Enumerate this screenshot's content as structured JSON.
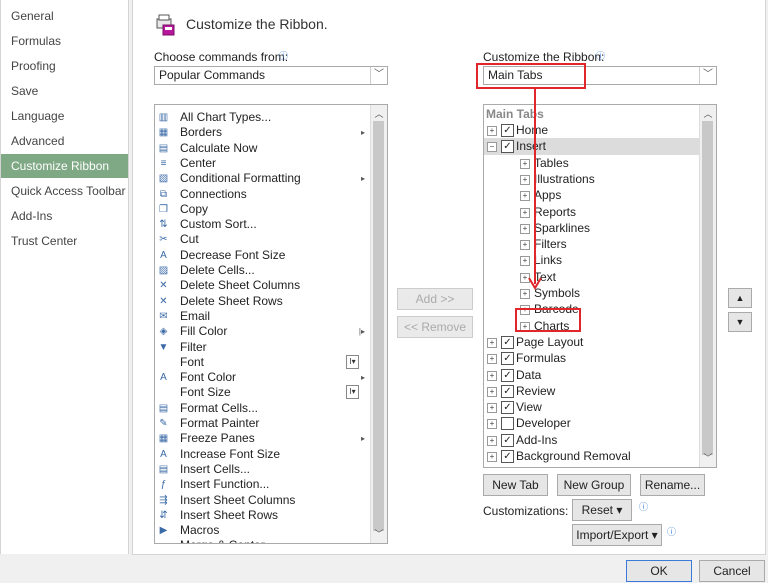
{
  "nav": {
    "items": [
      {
        "label": "General"
      },
      {
        "label": "Formulas"
      },
      {
        "label": "Proofing"
      },
      {
        "label": "Save"
      },
      {
        "label": "Language"
      },
      {
        "label": "Advanced"
      },
      {
        "label": "Customize Ribbon",
        "selected": true
      },
      {
        "label": "Quick Access Toolbar"
      },
      {
        "label": "Add-Ins"
      },
      {
        "label": "Trust Center"
      }
    ]
  },
  "header": {
    "title": "Customize the Ribbon.",
    "icon": "ribbon-customize-icon"
  },
  "left_pane": {
    "choose_label": "Choose commands from:",
    "choose_value": "Popular Commands",
    "commands": [
      {
        "label": "All Chart Types...",
        "icon": "chart-icon"
      },
      {
        "label": "Borders",
        "icon": "borders-icon",
        "sub": "▸"
      },
      {
        "label": "Calculate Now",
        "icon": "calculator-icon"
      },
      {
        "label": "Center",
        "icon": "align-center-icon"
      },
      {
        "label": "Conditional Formatting",
        "icon": "conditional-format-icon",
        "sub": "▸"
      },
      {
        "label": "Connections",
        "icon": "connections-icon"
      },
      {
        "label": "Copy",
        "icon": "copy-icon"
      },
      {
        "label": "Custom Sort...",
        "icon": "sort-icon"
      },
      {
        "label": "Cut",
        "icon": "scissors-icon"
      },
      {
        "label": "Decrease Font Size",
        "icon": "font-decrease-icon"
      },
      {
        "label": "Delete Cells...",
        "icon": "delete-cells-icon"
      },
      {
        "label": "Delete Sheet Columns",
        "icon": "delete-columns-icon"
      },
      {
        "label": "Delete Sheet Rows",
        "icon": "delete-rows-icon"
      },
      {
        "label": "Email",
        "icon": "email-icon"
      },
      {
        "label": "Fill Color",
        "icon": "fill-color-icon",
        "sub": "|▸"
      },
      {
        "label": "Filter",
        "icon": "filter-icon"
      },
      {
        "label": "Font",
        "icon": "",
        "box": "I▾"
      },
      {
        "label": "Font Color",
        "icon": "font-color-icon",
        "sub": "▸"
      },
      {
        "label": "Font Size",
        "icon": "",
        "box": "I▾"
      },
      {
        "label": "Format Cells...",
        "icon": "format-cells-icon"
      },
      {
        "label": "Format Painter",
        "icon": "format-painter-icon"
      },
      {
        "label": "Freeze Panes",
        "icon": "freeze-panes-icon",
        "sub": "▸"
      },
      {
        "label": "Increase Font Size",
        "icon": "font-increase-icon"
      },
      {
        "label": "Insert Cells...",
        "icon": "insert-cells-icon"
      },
      {
        "label": "Insert Function...",
        "icon": "function-icon"
      },
      {
        "label": "Insert Sheet Columns",
        "icon": "insert-columns-icon"
      },
      {
        "label": "Insert Sheet Rows",
        "icon": "insert-rows-icon"
      },
      {
        "label": "Macros",
        "icon": "macros-icon"
      },
      {
        "label": "Merge & Center",
        "icon": "merge-center-icon"
      }
    ]
  },
  "middle": {
    "add_label": "Add >>",
    "remove_label": "<< Remove"
  },
  "right_pane": {
    "customize_label": "Customize the Ribbon:",
    "customize_value": "Main Tabs",
    "tree_header": "Main Tabs",
    "tree": [
      {
        "label": "Home",
        "level": 0,
        "exp": "+",
        "checked": true
      },
      {
        "label": "Insert",
        "level": 0,
        "exp": "−",
        "checked": true,
        "selected": true
      },
      {
        "label": "Tables",
        "level": 1,
        "exp": "+"
      },
      {
        "label": "Illustrations",
        "level": 1,
        "exp": "+"
      },
      {
        "label": "Apps",
        "level": 1,
        "exp": "+"
      },
      {
        "label": "Reports",
        "level": 1,
        "exp": "+"
      },
      {
        "label": "Sparklines",
        "level": 1,
        "exp": "+"
      },
      {
        "label": "Filters",
        "level": 1,
        "exp": "+"
      },
      {
        "label": "Links",
        "level": 1,
        "exp": "+"
      },
      {
        "label": "Text",
        "level": 1,
        "exp": "+"
      },
      {
        "label": "Symbols",
        "level": 1,
        "exp": "+"
      },
      {
        "label": "Barcode",
        "level": 1,
        "exp": "+"
      },
      {
        "label": "Charts",
        "level": 1,
        "exp": "+"
      },
      {
        "label": "Page Layout",
        "level": 0,
        "exp": "+",
        "checked": true
      },
      {
        "label": "Formulas",
        "level": 0,
        "exp": "+",
        "checked": true
      },
      {
        "label": "Data",
        "level": 0,
        "exp": "+",
        "checked": true
      },
      {
        "label": "Review",
        "level": 0,
        "exp": "+",
        "checked": true
      },
      {
        "label": "View",
        "level": 0,
        "exp": "+",
        "checked": true
      },
      {
        "label": "Developer",
        "level": 0,
        "exp": "+",
        "checked": false
      },
      {
        "label": "Add-Ins",
        "level": 0,
        "exp": "+",
        "checked": true
      },
      {
        "label": "Background Removal",
        "level": 0,
        "exp": "+",
        "checked": true
      }
    ],
    "new_tab": "New Tab",
    "new_group": "New Group",
    "rename": "Rename...",
    "customizations_label": "Customizations:",
    "reset": "Reset ▾",
    "import_export": "Import/Export ▾"
  },
  "footer": {
    "ok": "OK",
    "cancel": "Cancel"
  },
  "colors": {
    "accent": "#7fa884",
    "annotation": "#e0262b",
    "info": "#3a7ad8"
  }
}
